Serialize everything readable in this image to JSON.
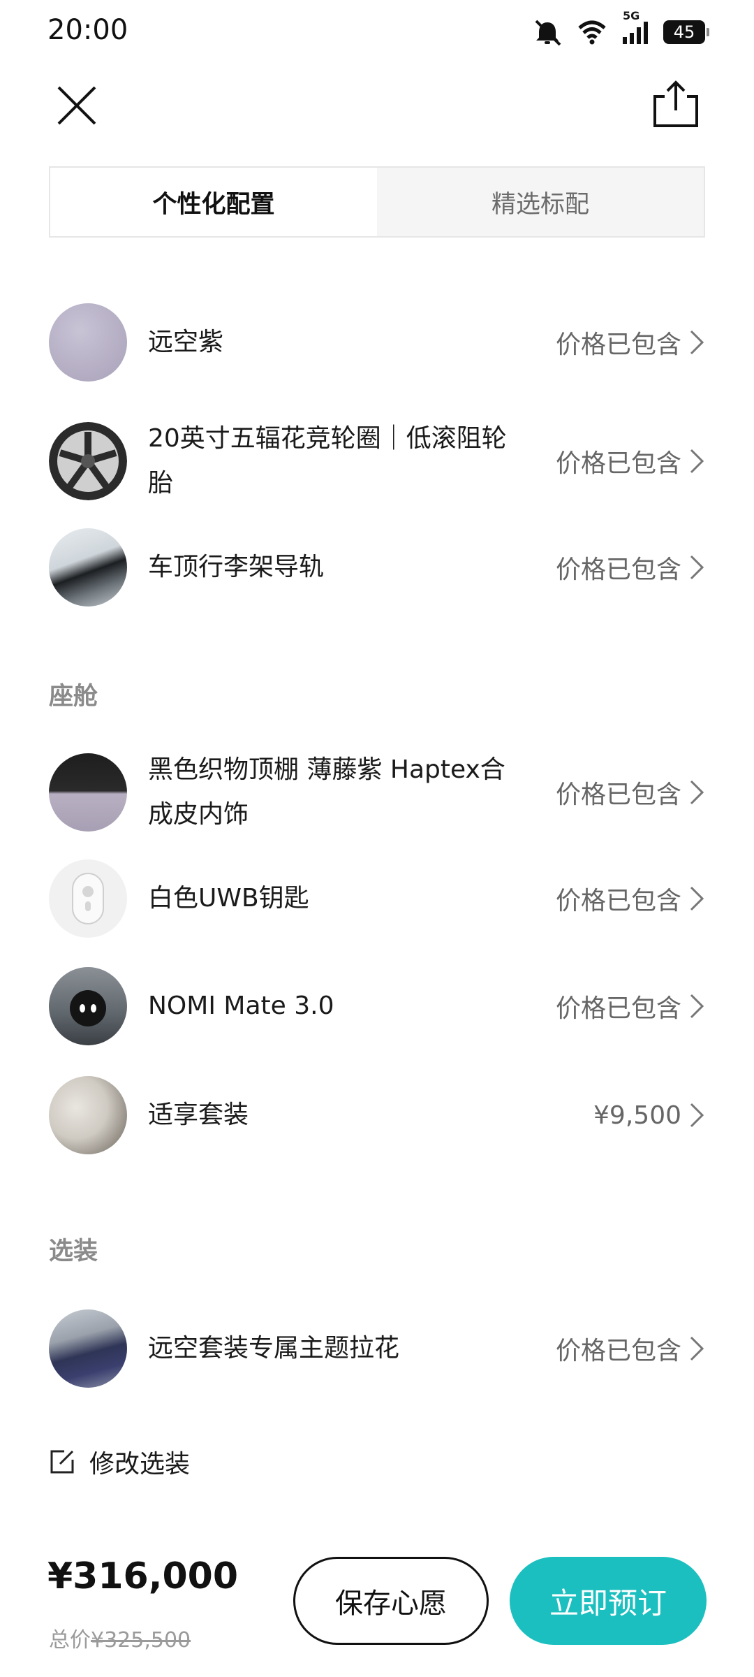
{
  "status_bar": {
    "time": "20:00",
    "network": "5G",
    "battery": "45",
    "icons": [
      "mute-icon",
      "wifi-icon",
      "signal-icon",
      "battery-icon"
    ]
  },
  "header": {
    "close_icon": "close-icon",
    "share_icon": "share-icon"
  },
  "tabs": [
    {
      "label": "个性化配置",
      "active": true
    },
    {
      "label": "精选标配",
      "active": false
    }
  ],
  "exterior": {
    "items": [
      {
        "title": "远空紫",
        "price": "价格已包含"
      },
      {
        "title": "20英寸五辐花竞轮圈｜低滚阻轮胎",
        "price": "价格已包含"
      },
      {
        "title": "车顶行李架导轨",
        "price": "价格已包含"
      }
    ]
  },
  "cabin": {
    "label": "座舱",
    "items": [
      {
        "title": "黑色织物顶棚 薄藤紫 Haptex合成皮内饰",
        "price": "价格已包含"
      },
      {
        "title": "白色UWB钥匙",
        "price": "价格已包含"
      },
      {
        "title": "NOMI Mate 3.0",
        "price": "价格已包含"
      },
      {
        "title": "适享套装",
        "price": "¥9,500"
      }
    ]
  },
  "options": {
    "label": "选装",
    "items": [
      {
        "title": "远空套装专属主题拉花",
        "price": "价格已包含"
      }
    ]
  },
  "modify": {
    "label": "修改选装",
    "icon": "edit-icon"
  },
  "footer": {
    "price": "¥316,000",
    "original_prefix": "总价",
    "original_price": "¥325,500",
    "save_label": "保存心愿",
    "order_label": "立即预订",
    "accent": "#1bbfbf"
  }
}
